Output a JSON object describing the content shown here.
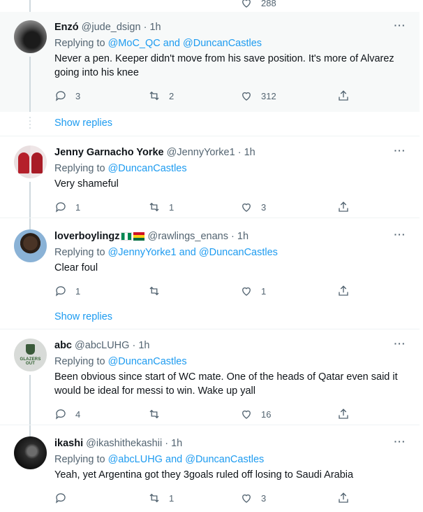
{
  "top_partial": {
    "like_count": "288"
  },
  "tweets": [
    {
      "name": "Enzó",
      "handle": "@jude_dsign",
      "time": "1h",
      "replying_prefix": "Replying to",
      "mentions": [
        "@MoC_QC",
        "@DuncanCastles"
      ],
      "joiner": "and",
      "text": "Never a pen. Keeper didn't move from his save position. It's more of Alvarez going into his knee",
      "replies": "3",
      "retweets": "2",
      "likes": "312"
    },
    {
      "name": "Jenny Garnacho Yorke",
      "handle": "@JennyYorke1",
      "time": "1h",
      "replying_prefix": "Replying to",
      "mentions": [
        "@DuncanCastles"
      ],
      "text": "Very shameful",
      "replies": "1",
      "retweets": "1",
      "likes": "3"
    },
    {
      "name": "loverboylingz",
      "handle": "@rawlings_enans",
      "time": "1h",
      "replying_prefix": "Replying to",
      "mentions": [
        "@JennyYorke1",
        "@DuncanCastles"
      ],
      "joiner": "and",
      "text": "Clear foul",
      "replies": "1",
      "retweets": "",
      "likes": "1"
    },
    {
      "name": "abc",
      "handle": "@abcLUHG",
      "time": "1h",
      "avatar_text": "GLAZERS OUT",
      "replying_prefix": "Replying to",
      "mentions": [
        "@DuncanCastles"
      ],
      "text_line1": "Been obvious since start of WC mate. One of the heads of Qatar even said it",
      "text_line2": "would be ideal for messi to win. Wake up yall",
      "replies": "4",
      "retweets": "",
      "likes": "16"
    },
    {
      "name": "ikashi",
      "handle": "@ikashithekashii",
      "time": "1h",
      "replying_prefix": "Replying to",
      "mentions": [
        "@abcLUHG",
        "@DuncanCastles"
      ],
      "joiner": "and",
      "text": "Yeah, yet Argentina got they 3goals ruled off losing to Saudi Arabia",
      "replies": "",
      "retweets": "1",
      "likes": "3"
    }
  ],
  "show_replies_label": "Show replies",
  "separator": "·",
  "icons": [
    "reply-icon",
    "retweet-icon",
    "like-icon",
    "share-icon",
    "more-icon"
  ]
}
